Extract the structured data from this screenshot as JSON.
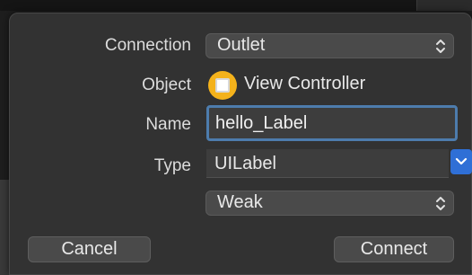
{
  "form": {
    "connection": {
      "label": "Connection",
      "value": "Outlet"
    },
    "object": {
      "label": "Object",
      "value": "View Controller"
    },
    "name": {
      "label": "Name",
      "value": "hello_Label"
    },
    "type": {
      "label": "Type",
      "value": "UILabel"
    },
    "storage": {
      "value": "Weak"
    }
  },
  "buttons": {
    "cancel": "Cancel",
    "connect": "Connect"
  },
  "icons": {
    "object": "view-controller-icon",
    "popup": "up-down-chevron-icon",
    "type_dropdown": "chevron-down-icon"
  },
  "colors": {
    "accent": "#2f6fd6",
    "focus_ring": "#4d7cad",
    "object_icon": "#f4b21b",
    "panel": "#323232"
  }
}
